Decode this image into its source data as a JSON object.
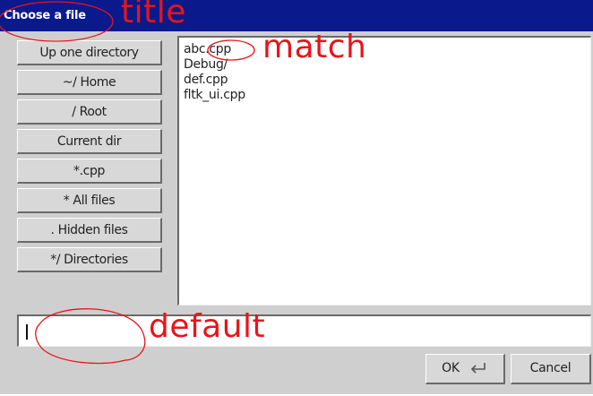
{
  "window": {
    "title": "Choose a file"
  },
  "sidebar": {
    "items": [
      {
        "label": "Up one directory",
        "icon": "up-arrow-icon"
      },
      {
        "label": "~/ Home",
        "icon": "home-icon"
      },
      {
        "label": "/ Root",
        "icon": "root-icon"
      },
      {
        "label": "Current dir",
        "icon": "folder-icon"
      },
      {
        "label": "*.cpp",
        "icon": "filter-icon"
      },
      {
        "label": "* All files",
        "icon": "filter-icon"
      },
      {
        "label": ". Hidden files",
        "icon": "filter-icon"
      },
      {
        "label": "*/ Directories",
        "icon": "filter-icon"
      }
    ]
  },
  "file_list": {
    "items": [
      "abc.cpp",
      "Debug/",
      "def.cpp",
      "fltk_ui.cpp"
    ]
  },
  "filename_input": {
    "value": ""
  },
  "buttons": {
    "ok": "OK",
    "cancel": "Cancel",
    "ok_icon": "return-arrow-icon"
  },
  "annotations": {
    "title": "title",
    "match": "match",
    "default": "default",
    "color": "#e8141a"
  },
  "colors": {
    "title_bar": "#0a1a8c",
    "dialog_bg": "#cfcfcf",
    "annotation": "#e8141a"
  }
}
